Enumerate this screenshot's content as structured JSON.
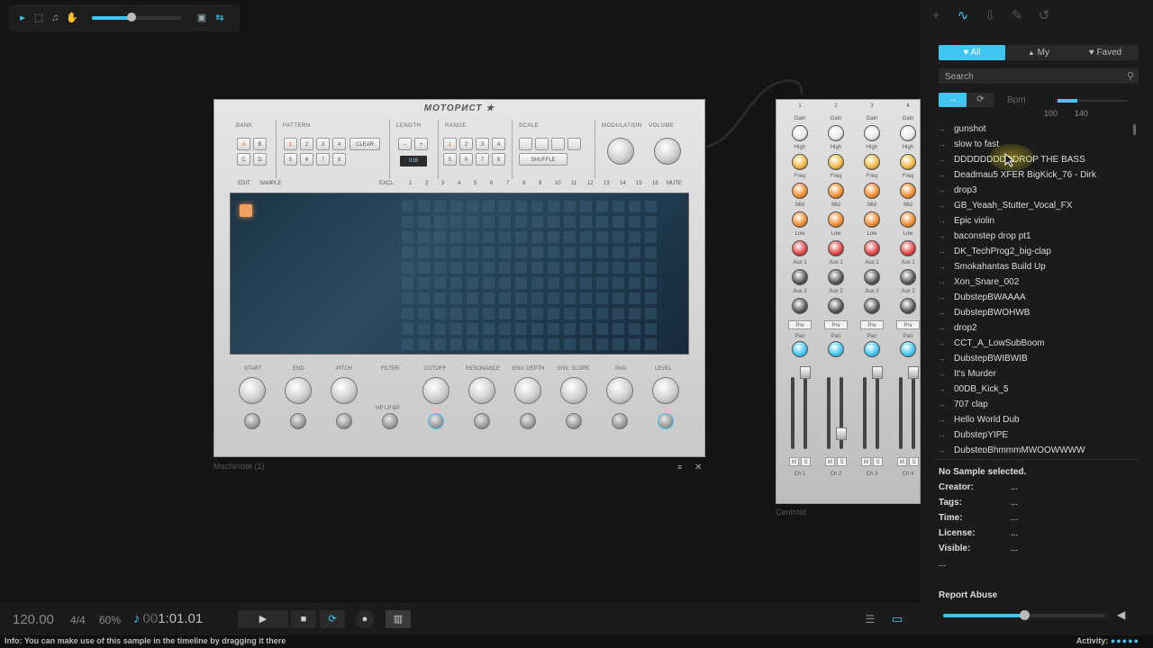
{
  "toolbar": {
    "zoom_level": 0.44
  },
  "machiniste": {
    "title": "МОТОРИСТ ★",
    "sections": {
      "bank": "BANK",
      "pattern": "PATTERN",
      "length": "LENGTH",
      "range": "RANGE",
      "scale": "SCALE",
      "modulation": "MODULATION",
      "volume": "VOLUME"
    },
    "bank_pads": [
      "A",
      "B",
      "C",
      "D"
    ],
    "pattern_pads": [
      "1",
      "2",
      "3",
      "4",
      "5",
      "6",
      "7",
      "8"
    ],
    "clear_label": "CLEAR",
    "length_minus": "–",
    "length_plus": "+",
    "length_value": "016",
    "range_pads": [
      "1",
      "2",
      "3",
      "4",
      "5",
      "6",
      "7",
      "8"
    ],
    "scale_pads": [
      "",
      "",
      "",
      ""
    ],
    "shuffle_label": "SHUFFLE",
    "edit_label": "EDIT",
    "sample_label": "SAMPLE",
    "excl_label": "EXCL.",
    "mute_label": "MUTE",
    "steps": [
      "1",
      "2",
      "3",
      "4",
      "5",
      "6",
      "7",
      "8",
      "9",
      "10",
      "11",
      "12",
      "13",
      "14",
      "15",
      "16"
    ],
    "lower_labels": {
      "start": "START",
      "end": "END",
      "pitch": "PITCH",
      "filter": "FILTER",
      "cutoff": "CUTOFF",
      "resonance": "RESONANCE",
      "env_depth": "ENV. DEPTH",
      "env_slope": "ENV. SLOPE",
      "pan": "PAN",
      "level": "LEVEL"
    },
    "filter_modes": "HP  LP  BP",
    "footer": "Machiniste (1)"
  },
  "centroid": {
    "label": "Centroid",
    "channels": [
      {
        "num": "1",
        "name": "Ch 1"
      },
      {
        "num": "2",
        "name": "Ch 2"
      },
      {
        "num": "3",
        "name": "Ch 3"
      },
      {
        "num": "4",
        "name": "Ch 4"
      }
    ],
    "knob_labels": {
      "gain": "Gain",
      "high": "High",
      "freq": "Freq",
      "mid": "Mid",
      "low": "Low",
      "aux1": "Aux 1",
      "aux2": "Aux 2",
      "pan": "Pan"
    },
    "pre_label": "Pre",
    "mute_label": "M",
    "solo_label": "S",
    "colors": {
      "gain": "#e8e8e8",
      "high": "#f2b63a",
      "freq": "#f28a2a",
      "low": "#e04040",
      "aux": "#555555",
      "pan": "#3ec6f0"
    }
  },
  "right_panel": {
    "filter_tabs": [
      {
        "label": "All",
        "icon": "♥"
      },
      {
        "label": "My",
        "icon": "👤"
      },
      {
        "label": "Faved",
        "icon": "♥"
      }
    ],
    "search_placeholder": "Search",
    "bpm_label": "Bpm",
    "bpm_min": "100",
    "bpm_max": "140",
    "samples": [
      "gunshot",
      "slow to fast",
      "DDDDDDDDDDROP THE BASS",
      "Deadmau5 XFER BigKick_76 - Dirk",
      "drop3",
      "GB_Yeaah_Stutter_Vocal_FX",
      "Epic violin",
      "baconstep drop pt1",
      "DK_TechProg2_big-clap",
      "Smokahantas Build Up",
      "Xon_Snare_002",
      "DubstepBWAAAA",
      "DubstepBWOHWB",
      "drop2",
      "CCT_A_LowSubBoom",
      "DubstepBWIBWIB",
      "It's Murder",
      "00DB_Kick_5",
      "707 clap",
      "Hello World Dub",
      "DubstepYIPE",
      "DubstepBhmmmMWOOWWWW"
    ],
    "no_sample": "No Sample selected.",
    "meta": [
      {
        "label": "Creator:",
        "value": "..."
      },
      {
        "label": "Tags:",
        "value": "..."
      },
      {
        "label": "Time:",
        "value": "..."
      },
      {
        "label": "License:",
        "value": "..."
      },
      {
        "label": "Visible:",
        "value": "..."
      }
    ],
    "extra": "...",
    "report_abuse": "Report Abuse",
    "volume_level": 0.5
  },
  "transport": {
    "tempo": "120.00",
    "time_signature": "4/4",
    "swing": "60%",
    "position_prefix": "00",
    "position": "1:01.01"
  },
  "status": {
    "info": "Info: You can make use of this sample in the timeline by dragging it there",
    "activity_label": "Activity:",
    "activity_dots": "●●●●●"
  },
  "accent_color": "#3ec6f0"
}
